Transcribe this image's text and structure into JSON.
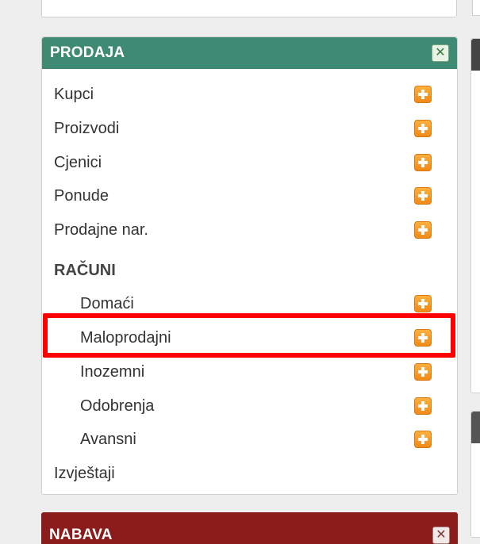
{
  "panel": {
    "title": "PRODAJA",
    "items": [
      "Kupci",
      "Proizvodi",
      "Cjenici",
      "Ponude",
      "Prodajne nar."
    ],
    "section_title": "RAČUNI",
    "sub_items": [
      "Domaći",
      "Maloprodajni",
      "Inozemni",
      "Odobrenja",
      "Avansni"
    ],
    "footer_item": "Izvještaji",
    "close_icon": "✕"
  },
  "bottom_panel": {
    "title": "NABAVA",
    "close_icon": "✕"
  },
  "colors": {
    "header_green": "#3e8a72",
    "header_red": "#8b1c1c",
    "plus_orange": "#f08a1a",
    "highlight": "#ff0000"
  }
}
